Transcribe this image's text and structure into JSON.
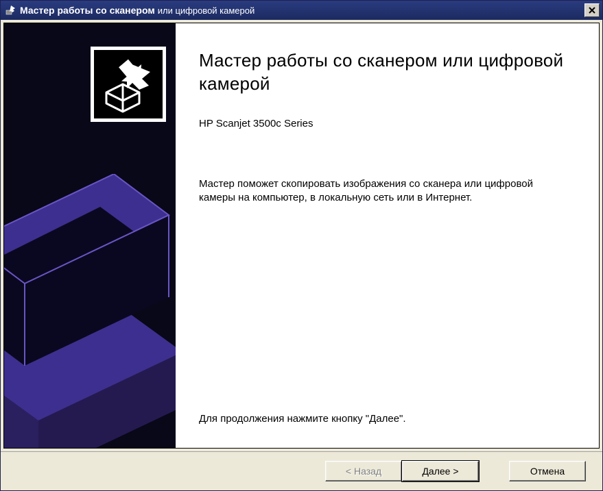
{
  "titlebar": {
    "main": "Мастер работы со сканером",
    "sub": "или цифровой камерой"
  },
  "content": {
    "heading": "Мастер работы со сканером или цифровой камерой",
    "device_name": "HP Scanjet 3500c Series",
    "description": "Мастер поможет скопировать изображения со сканера или цифровой камеры на компьютер, в локальную сеть или в Интернет.",
    "continue_hint": "Для продолжения нажмите кнопку \"Далее\"."
  },
  "buttons": {
    "back": "< Назад",
    "next": "Далее >",
    "cancel": "Отмена"
  },
  "icons": {
    "title_icon": "export-arrow-icon",
    "sidebar_logo": "export-arrow-icon",
    "scanner_art": "scanner-illustration",
    "close": "close-icon"
  },
  "colors": {
    "titlebar_gradient_top": "#2a3c80",
    "titlebar_gradient_bottom": "#1c2a60",
    "sidebar_bg": "#080818",
    "scanner_purple": "#3d2f8f",
    "scanner_dark": "#2a205f",
    "dialog_bg": "#ece9d8"
  }
}
